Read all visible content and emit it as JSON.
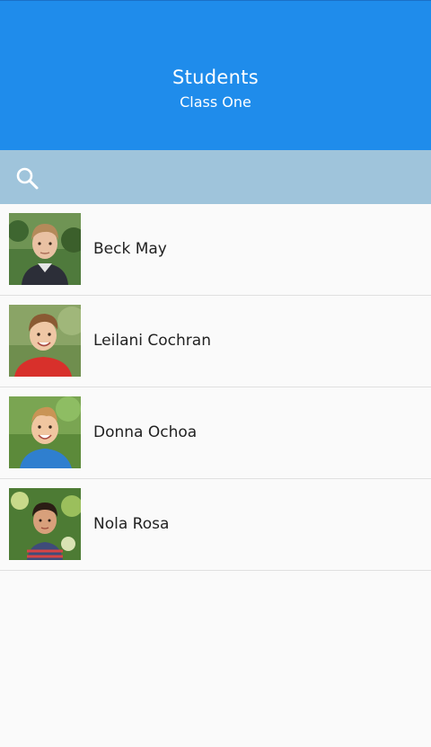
{
  "header": {
    "title": "Students",
    "subtitle": "Class One"
  },
  "search": {
    "placeholder": "",
    "value": "",
    "icon": "search-icon"
  },
  "students": [
    {
      "name": "Beck May"
    },
    {
      "name": "Leilani Cochran"
    },
    {
      "name": "Donna Ochoa"
    },
    {
      "name": "Nola Rosa"
    }
  ],
  "colors": {
    "header_bg": "#1f8ceb",
    "search_bg": "#9fc4db",
    "list_bg": "#fafafa",
    "divider": "#e0e0e0"
  }
}
